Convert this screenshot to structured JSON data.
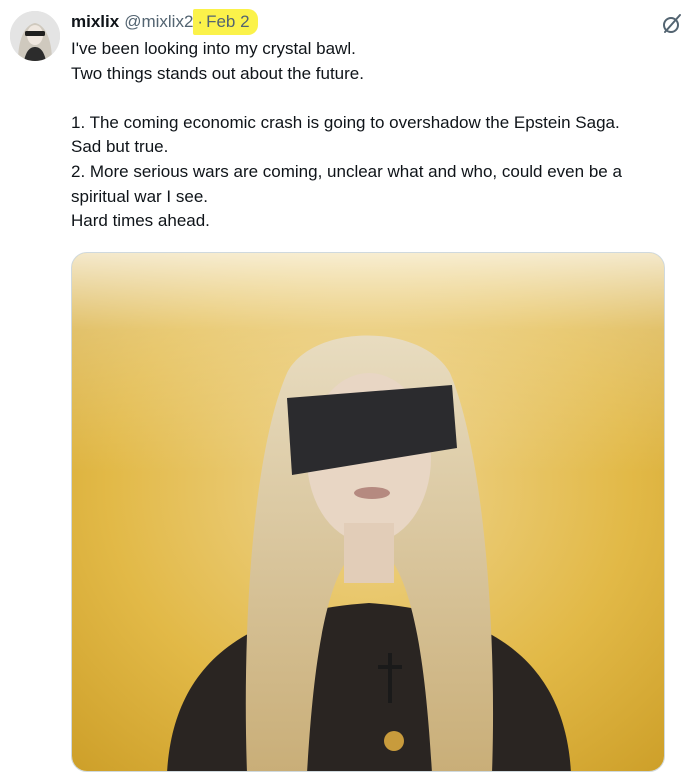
{
  "tweet": {
    "display_name": "mixlix",
    "handle": "@mixlix2",
    "separator": "·",
    "date": "Feb 2",
    "highlight_color": "#fbf24a",
    "icon": "grok-icon",
    "lines": [
      "I've been looking into my crystal bawl.",
      "Two things stands out about the future.",
      "",
      "1. The coming economic crash is going to overshadow the Epstein Saga.",
      "Sad but true.",
      "2. More serious wars are coming, unclear what and who, could even be a",
      "spiritual war I see.",
      "Hard times ahead."
    ]
  },
  "colors": {
    "text": "#0f1419",
    "secondary": "#536471",
    "media_background": "#d9aa2e"
  }
}
